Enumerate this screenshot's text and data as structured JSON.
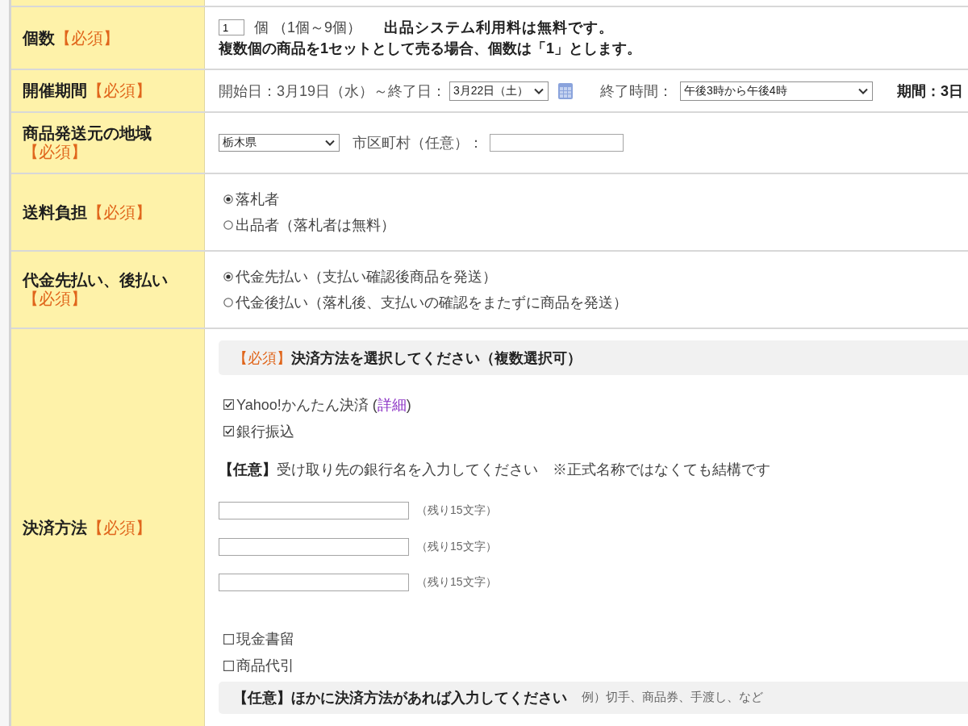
{
  "rows": [
    {
      "kind": "quantity",
      "label": "個数",
      "required_mark": "【必須】",
      "quantity": "1",
      "unit_note": "個 （1個～9個）",
      "fee_note": "出品システム利用料は無料です。",
      "set_note": "複数個の商品を1セットとして売る場合、個数は「1」とします。"
    },
    {
      "kind": "period",
      "label": "開催期間",
      "required_mark": "【必須】",
      "start_text": "開始日：3月19日（水）～終了日：",
      "end_date": "3月22日（土）",
      "end_time_label": "終了時間：",
      "end_time": "午後3時から午後4時",
      "duration": "期間：3日"
    },
    {
      "kind": "region",
      "label": "商品発送元の地域",
      "required_mark": "【必須】",
      "prefecture": "栃木県",
      "city_label": "市区町村（任意）："
    },
    {
      "kind": "radio",
      "label": "送料負担",
      "required_mark": "【必須】",
      "options": [
        {
          "label": "落札者",
          "selected": true
        },
        {
          "label": "出品者（落札者は無料）",
          "selected": false
        }
      ]
    },
    {
      "kind": "radio",
      "label": "代金先払い、後払い",
      "required_mark": "【必須】",
      "options": [
        {
          "label": "代金先払い（支払い確認後商品を発送）",
          "selected": true
        },
        {
          "label": "代金後払い（落札後、支払いの確認をまたずに商品を発送）",
          "selected": false
        }
      ]
    },
    {
      "kind": "payment",
      "label": "決済方法",
      "required_mark": "【必須】",
      "header": {
        "required_mark": "【必須】",
        "text": "決済方法を選択してください（複数選択可）"
      },
      "options": [
        {
          "label": "Yahoo!かんたん決済 (",
          "link": "詳細",
          "label_tail": ")",
          "checked": true
        },
        {
          "label": "銀行振込",
          "checked": true
        }
      ],
      "bank_note": "**【任意】**受け取り先の銀行名を入力してください　※正式名称ではなくても結構です",
      "bank_fields": [
        {
          "counter": "（残り15文字）"
        },
        {
          "counter": "（残り15文字）"
        },
        {
          "counter": "（残り15文字）"
        }
      ],
      "more_options": [
        {
          "label": "現金書留",
          "checked": false
        },
        {
          "label": "商品代引",
          "checked": false
        }
      ],
      "other": {
        "text": "【任意】ほかに決済方法があれば入力してください",
        "example": "例）切手、商品券、手渡し、など"
      }
    }
  ]
}
